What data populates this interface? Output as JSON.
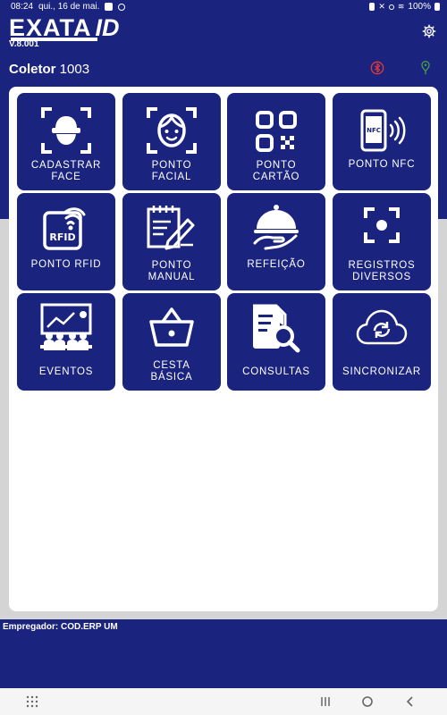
{
  "status_bar": {
    "time": "08:24",
    "date": "qui., 16 de mai.",
    "battery": "100%"
  },
  "header": {
    "logo_text": "EXATA",
    "logo_suffix": "ID",
    "version": "V.8.001",
    "coletor_label": "Coletor",
    "coletor_number": "1003"
  },
  "tiles": [
    {
      "label": "CADASTRAR\nFACE",
      "icon": "face-scan-icon"
    },
    {
      "label": "PONTO\nFACIAL",
      "icon": "face-icon"
    },
    {
      "label": "PONTO\nCARTÃO",
      "icon": "qr-code-icon"
    },
    {
      "label": "PONTO NFC",
      "icon": "nfc-phone-icon"
    },
    {
      "label": "PONTO RFID",
      "icon": "rfid-card-icon"
    },
    {
      "label": "PONTO\nMANUAL",
      "icon": "notepad-pen-icon"
    },
    {
      "label": "REFEIÇÃO",
      "icon": "cloche-icon"
    },
    {
      "label": "REGISTROS\nDIVERSOS",
      "icon": "focus-icon"
    },
    {
      "label": "EVENTOS",
      "icon": "presentation-icon"
    },
    {
      "label": "CESTA\nBÁSICA",
      "icon": "basket-icon"
    },
    {
      "label": "CONSULTAS",
      "icon": "document-search-icon"
    },
    {
      "label": "SINCRONIZAR",
      "icon": "cloud-sync-icon"
    }
  ],
  "footer": {
    "empregador": "Empregador: COD.ERP UM"
  },
  "colors": {
    "primary": "#1a237e",
    "bluetooth_icon": "#e53935",
    "location_icon": "#43a047"
  }
}
